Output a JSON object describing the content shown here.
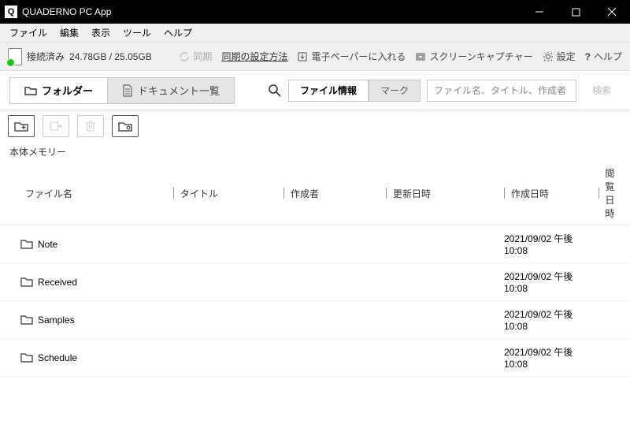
{
  "titlebar": {
    "app_icon_letter": "Q",
    "title": "QUADERNO PC App"
  },
  "menubar": {
    "items": [
      "ファイル",
      "編集",
      "表示",
      "ツール",
      "ヘルプ"
    ]
  },
  "status": {
    "connection_label": "接続済み",
    "storage": "24.78GB / 25.05GB",
    "sync_label": "同期",
    "sync_settings_link": "同期の設定方法",
    "send_to_epaper": "電子ペーパーに入れる",
    "screen_capture": "スクリーンキャプチャー",
    "settings": "設定",
    "help_q": "?",
    "help": "ヘルプ"
  },
  "tabs": {
    "folder": "フォルダー",
    "doclist": "ドキュメント一覧"
  },
  "search": {
    "seg_fileinfo": "ファイル情報",
    "seg_mark": "マーク",
    "placeholder": "ファイル名、タイトル、作成者",
    "button": "検索"
  },
  "breadcrumb": "本体メモリー",
  "columns": {
    "name": "ファイル名",
    "title": "タイトル",
    "author": "作成者",
    "updated": "更新日時",
    "created": "作成日時",
    "viewed": "閲覧日時"
  },
  "rows": [
    {
      "name": "Note",
      "created": "2021/09/02 午後 10:08"
    },
    {
      "name": "Received",
      "created": "2021/09/02 午後 10:08"
    },
    {
      "name": "Samples",
      "created": "2021/09/02 午後 10:08"
    },
    {
      "name": "Schedule",
      "created": "2021/09/02 午後 10:08"
    }
  ]
}
